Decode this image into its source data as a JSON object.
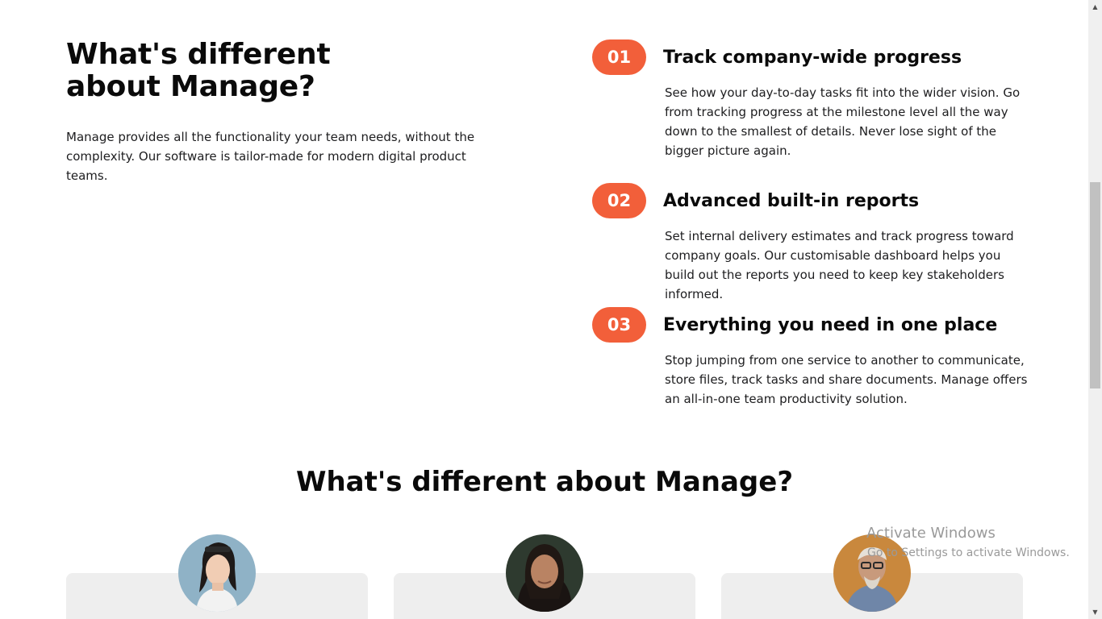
{
  "intro": {
    "title": "What's different about Manage?",
    "text": "Manage provides all the functionality your team needs, without the complexity. Our software is tailor-made for modern digital product teams."
  },
  "features": [
    {
      "number": "01",
      "title": "Track company-wide progress",
      "text": "See how your day-to-day tasks fit into the wider vision. Go from tracking progress at the milestone level all the way down to the smallest of details. Never lose sight of the bigger picture again."
    },
    {
      "number": "02",
      "title": "Advanced built-in reports",
      "text": "Set internal delivery estimates and track progress toward company goals. Our customisable dashboard helps you build out the reports you need to keep key stakeholders informed."
    },
    {
      "number": "03",
      "title": "Everything you need in one place",
      "text": "Stop jumping from one service to another to communicate, store files, track tasks and share documents. Manage offers an all-in-one team productivity solution."
    }
  ],
  "testimonials": {
    "title": "What's different about Manage?"
  },
  "watermark": {
    "title": "Activate Windows",
    "subtitle": "Go to Settings to activate Windows."
  },
  "colors": {
    "accent": "#f25f3a",
    "card": "#eeeeee",
    "text": "#1d1d1f"
  }
}
